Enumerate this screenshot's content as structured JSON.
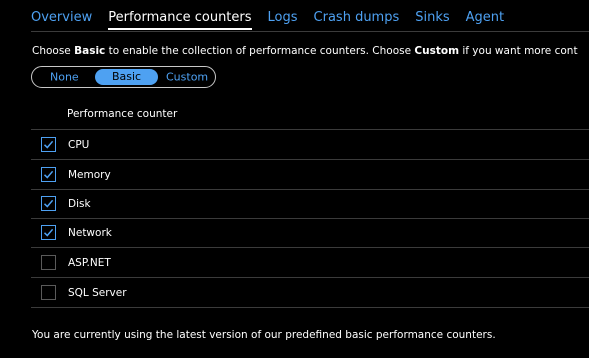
{
  "tabs": [
    {
      "label": "Overview",
      "active": false
    },
    {
      "label": "Performance counters",
      "active": true
    },
    {
      "label": "Logs",
      "active": false
    },
    {
      "label": "Crash dumps",
      "active": false
    },
    {
      "label": "Sinks",
      "active": false
    },
    {
      "label": "Agent",
      "active": false
    }
  ],
  "description": {
    "part1": "Choose ",
    "bold1": "Basic",
    "part2": " to enable the collection of performance counters. Choose ",
    "bold2": "Custom",
    "part3": " if you want more cont"
  },
  "mode_toggle": {
    "options": [
      "None",
      "Basic",
      "Custom"
    ],
    "selected": "Basic"
  },
  "table": {
    "header": "Performance counter",
    "rows": [
      {
        "label": "CPU",
        "checked": true
      },
      {
        "label": "Memory",
        "checked": true
      },
      {
        "label": "Disk",
        "checked": true
      },
      {
        "label": "Network",
        "checked": true
      },
      {
        "label": "ASP.NET",
        "checked": false
      },
      {
        "label": "SQL Server",
        "checked": false
      }
    ]
  },
  "note": "You are currently using the latest version of our predefined basic performance counters.",
  "colors": {
    "accent": "#4ea1f2",
    "background": "#000000",
    "divider": "#3b3b3b"
  },
  "icons": {
    "checkbox_checked": "checkmark-icon"
  }
}
